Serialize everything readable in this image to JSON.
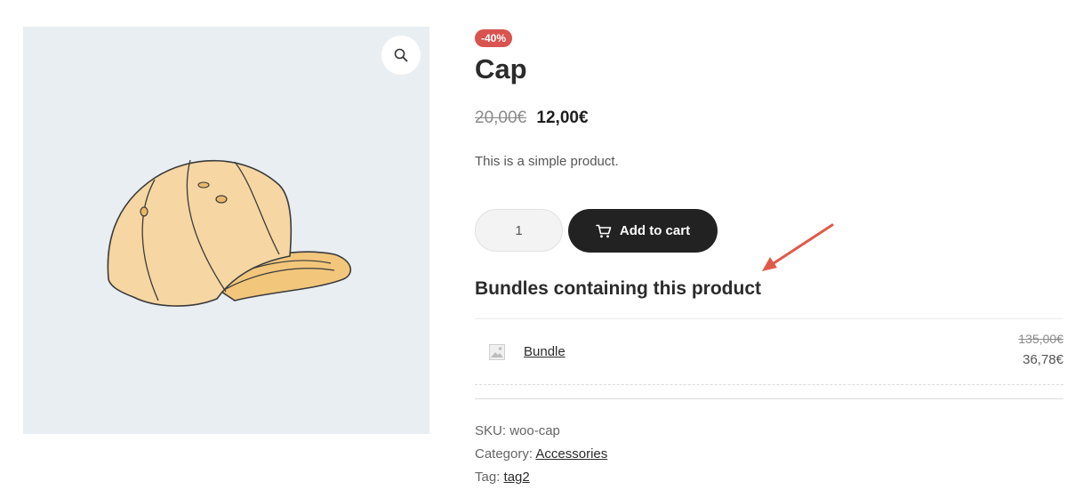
{
  "product": {
    "sale_badge": "-40%",
    "title": "Cap",
    "old_price": "20,00€",
    "new_price": "12,00€",
    "description": "This is a simple product.",
    "quantity": "1",
    "add_to_cart_label": "Add to cart",
    "image_icon": "cap-illustration",
    "zoom_icon": "search-icon"
  },
  "bundles": {
    "heading": "Bundles containing this product",
    "items": [
      {
        "name": "Bundle",
        "old_price": "135,00€",
        "new_price": "36,78€",
        "thumb_icon": "image-placeholder-icon"
      }
    ]
  },
  "meta": {
    "sku_label": "SKU:",
    "sku_value": "woo-cap",
    "category_label": "Category:",
    "category_value": "Accessories",
    "tag_label": "Tag:",
    "tag_value": "tag2"
  },
  "colors": {
    "badge": "#d9534f",
    "button": "#222222",
    "gallery_bg": "#e9eef3",
    "arrow": "#e05a4a"
  }
}
